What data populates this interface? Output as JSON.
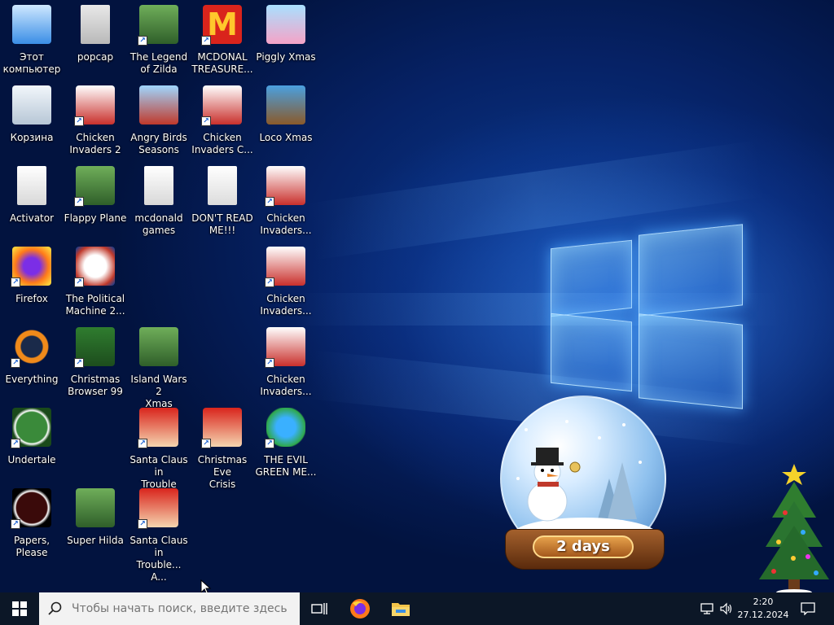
{
  "desktop": {
    "icons": [
      {
        "label": "Этот\nкомпьютер",
        "icon": "this-pc-icon",
        "shortcut": false
      },
      {
        "label": "popcap",
        "icon": "folder-icon",
        "shortcut": false
      },
      {
        "label": "The Legend\nof Zilda",
        "icon": "game-icon",
        "shortcut": true
      },
      {
        "label": "MCDONAL\nTREASURE...",
        "icon": "mcdonalds-icon",
        "shortcut": true
      },
      {
        "label": "Piggly Xmas",
        "icon": "pig-icon",
        "shortcut": false
      },
      {
        "label": "Корзина",
        "icon": "recycle-bin-icon",
        "shortcut": false
      },
      {
        "label": "Chicken\nInvaders 2",
        "icon": "chicken-icon",
        "shortcut": true
      },
      {
        "label": "Angry Birds\nSeasons",
        "icon": "angry-birds-icon",
        "shortcut": false
      },
      {
        "label": "Chicken\nInvaders C...",
        "icon": "chicken-icon",
        "shortcut": true
      },
      {
        "label": "Loco Xmas",
        "icon": "bear-icon",
        "shortcut": false
      },
      {
        "label": "Activator",
        "icon": "file-icon",
        "shortcut": false
      },
      {
        "label": "Flappy Plane",
        "icon": "game-icon",
        "shortcut": true
      },
      {
        "label": "mcdonald\ngames",
        "icon": "file-icon",
        "shortcut": false
      },
      {
        "label": "DON'T READ\nME!!!",
        "icon": "text-file-icon",
        "shortcut": false
      },
      {
        "label": "Chicken\nInvaders...",
        "icon": "chicken-icon",
        "shortcut": true
      },
      {
        "label": "Firefox",
        "icon": "firefox-icon",
        "shortcut": true
      },
      {
        "label": "The Political\nMachine 2...",
        "icon": "political-machine-icon",
        "shortcut": true
      },
      {
        "label": "Chicken\nInvaders...",
        "icon": "chicken-icon",
        "shortcut": true
      },
      {
        "label": "Everything",
        "icon": "everything-search-icon",
        "shortcut": true
      },
      {
        "label": "Christmas\nBrowser 99",
        "icon": "christmas-tree-icon",
        "shortcut": true
      },
      {
        "label": "Island Wars 2\nXmas",
        "icon": "game-icon",
        "shortcut": false
      },
      {
        "label": "Chicken\nInvaders...",
        "icon": "chicken-icon",
        "shortcut": true
      },
      {
        "label": "Undertale",
        "icon": "undertale-icon",
        "shortcut": true
      },
      {
        "label": "Santa Claus in\nTrouble",
        "icon": "santa-icon",
        "shortcut": true
      },
      {
        "label": "Christmas Eve\nCrisis",
        "icon": "santa-icon",
        "shortcut": true
      },
      {
        "label": "THE EVIL\nGREEN ME...",
        "icon": "msn-icon",
        "shortcut": true
      },
      {
        "label": "Papers, Please",
        "icon": "papers-please-icon",
        "shortcut": true
      },
      {
        "label": "Super Hilda",
        "icon": "game-icon",
        "shortcut": false
      },
      {
        "label": "Santa Claus in\nTrouble... A...",
        "icon": "santa-icon",
        "shortcut": true
      }
    ]
  },
  "snowglobe": {
    "countdown": "2 days"
  },
  "taskbar": {
    "search_placeholder": "Чтобы начать поиск, введите здесь",
    "time": "2:20",
    "date": "27.12.2024"
  },
  "colors": {
    "taskbar": "#0c1727",
    "accent": "#1a5fd0"
  }
}
